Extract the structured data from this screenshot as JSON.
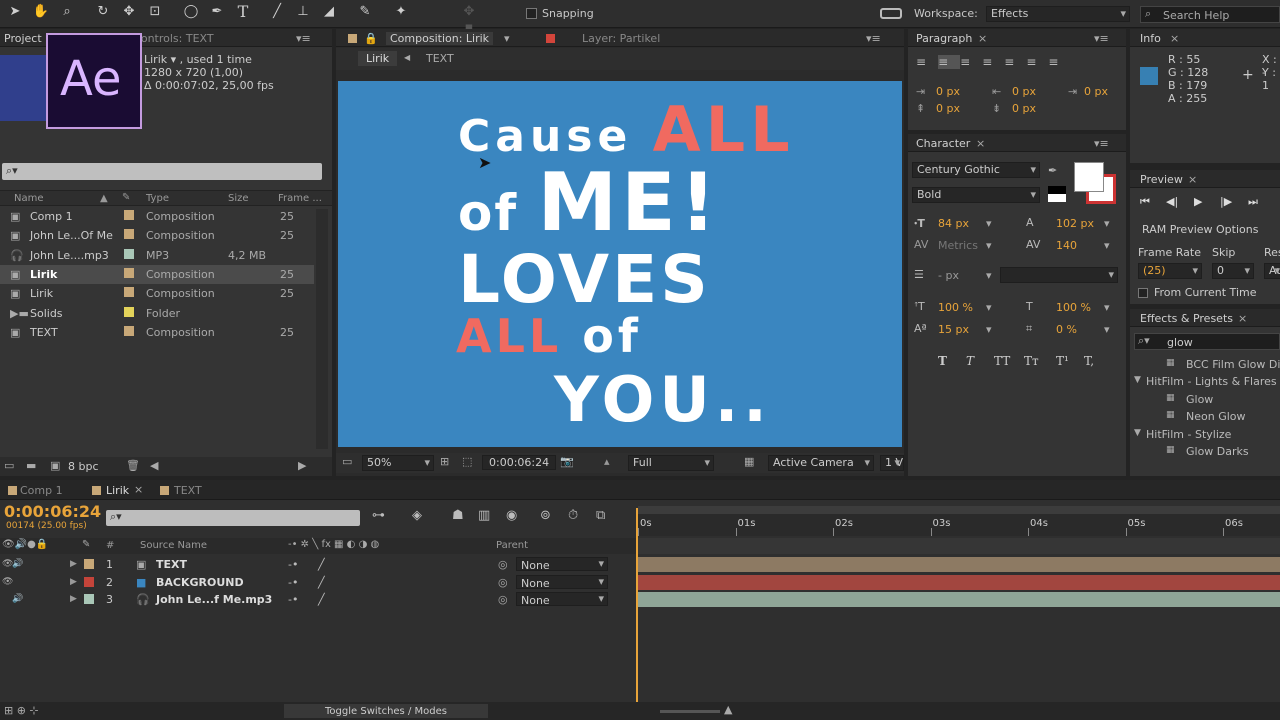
{
  "toolbar": {
    "snapping": "Snapping",
    "workspace_label": "Workspace:",
    "workspace_value": "Effects",
    "search_placeholder": "Search Help"
  },
  "project": {
    "tab": "Project",
    "controls_tab": "Effect Controls: TEXT",
    "sel_name": "Lirik ▾ , used 1 time",
    "sel_dim": "1280 x 720 (1,00)",
    "sel_dur": "Δ 0:00:07:02, 25,00 fps",
    "logo": "Ae",
    "headers": [
      "Name",
      "Type",
      "Size",
      "Frame ..."
    ],
    "items": [
      {
        "name": "Comp 1",
        "type": "Composition",
        "size": "",
        "frame": "25",
        "color": "#c8a878"
      },
      {
        "name": "John Le...Of Me",
        "type": "Composition",
        "size": "",
        "frame": "25",
        "color": "#c8a878"
      },
      {
        "name": "John Le....mp3",
        "type": "MP3",
        "size": "4,2 MB",
        "frame": "",
        "color": "#a9c7b7"
      },
      {
        "name": "Lirik",
        "type": "Composition",
        "size": "",
        "frame": "25",
        "color": "#c8a878"
      },
      {
        "name": "Lirik",
        "type": "Composition",
        "size": "",
        "frame": "25",
        "color": "#c8a878"
      },
      {
        "name": "Solids",
        "type": "Folder",
        "size": "",
        "frame": "",
        "color": "#e3d35a"
      },
      {
        "name": "TEXT",
        "type": "Composition",
        "size": "",
        "frame": "25",
        "color": "#c8a878"
      }
    ],
    "bpc": "8 bpc"
  },
  "viewer": {
    "comp_tab": "Composition: Lirik",
    "layer_tab": "Layer: Partikel",
    "crumb1": "Lirik",
    "crumb2": "TEXT",
    "lines": [
      {
        "a": "Cause ",
        "b": "ALL"
      },
      {
        "a": "of ",
        "b": "ME!"
      },
      {
        "a": "LOVES",
        "b": ""
      },
      {
        "a": "ALL",
        "b": " of"
      },
      {
        "a": "YOU..",
        "b": ""
      }
    ],
    "zoom": "50%",
    "time": "0:00:06:24",
    "res": "Full",
    "camera": "Active Camera",
    "views": "1 V",
    "bg": "#3a86c0",
    "accent": "#f06a60"
  },
  "paragraph": {
    "tab": "Paragraph",
    "vals": [
      "0 px",
      "0 px",
      "0 px",
      "0 px",
      "0 px"
    ]
  },
  "character": {
    "tab": "Character",
    "font": "Century Gothic",
    "style": "Bold",
    "size": "84 px",
    "leading": "102 px",
    "kerning": "Metrics",
    "tracking": "140",
    "stroke": "- px",
    "vscale": "100 %",
    "hscale": "100 %",
    "baseline": "15 px",
    "tsume": "0 %",
    "styles": [
      "T",
      "T",
      "TT",
      "Tт",
      "T¹",
      "T,"
    ]
  },
  "info": {
    "tab": "Info",
    "r": "R : 55",
    "g": "G : 128",
    "b": "B : 179",
    "a": "A : 255",
    "x": "X : -",
    "y": "Y : 1",
    "swatch": "#3780b3"
  },
  "preview": {
    "tab": "Preview",
    "ram": "RAM Preview Options",
    "frame_rate": "Frame Rate",
    "skip": "Skip",
    "res": "Res",
    "rate": "(25)",
    "skipval": "0",
    "resval": "Au",
    "from_current": "From Current Time"
  },
  "effects": {
    "tab": "Effects & Presets",
    "search": "glow",
    "items": [
      {
        "t": "BCC Film Glow Di",
        "kind": "effect"
      },
      {
        "t": "HitFilm - Lights & Flares",
        "kind": "group"
      },
      {
        "t": "Glow",
        "kind": "effect"
      },
      {
        "t": "Neon Glow",
        "kind": "effect"
      },
      {
        "t": "HitFilm - Stylize",
        "kind": "group"
      },
      {
        "t": "Glow Darks",
        "kind": "effect"
      }
    ]
  },
  "timeline": {
    "tabs": [
      "Comp 1",
      "Lirik",
      "TEXT"
    ],
    "timecode": "0:00:06:24",
    "frames": "00174 (25.00 fps)",
    "col_source": "Source Name",
    "col_parent": "Parent",
    "hash": "#",
    "ticks": [
      "0s",
      "01s",
      "02s",
      "03s",
      "04s",
      "05s",
      "06s"
    ],
    "layers": [
      {
        "num": "1",
        "name": "TEXT",
        "parent": "None",
        "color": "#c8a878",
        "bar": "#8d7a63"
      },
      {
        "num": "2",
        "name": "BACKGROUND",
        "parent": "None",
        "color": "#c4443a",
        "bar": "#a2463f"
      },
      {
        "num": "3",
        "name": "John Le...f Me.mp3",
        "parent": "None",
        "color": "#a9c7b7",
        "bar": "#8fa597"
      }
    ],
    "toggle": "Toggle Switches / Modes"
  }
}
